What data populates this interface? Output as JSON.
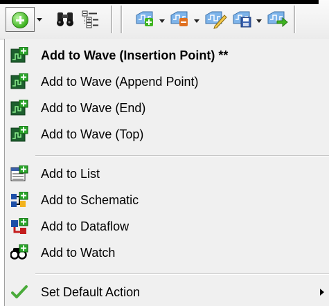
{
  "toolbar": {
    "icons": [
      "add-icon",
      "chevron-down-icon",
      "find-icon",
      "tree-icon",
      "wave-add-icon",
      "wave-remove-icon",
      "wave-edit-icon",
      "wave-save-icon",
      "wave-export-icon"
    ]
  },
  "menu": {
    "items": [
      {
        "label": "Add to Wave (Insertion Point) **",
        "icon": "wave-insert-icon",
        "bold": true
      },
      {
        "label": "Add to Wave (Append Point)",
        "icon": "wave-append-icon"
      },
      {
        "label": "Add to Wave (End)",
        "icon": "wave-end-icon"
      },
      {
        "label": "Add to Wave (Top)",
        "icon": "wave-top-icon"
      },
      {
        "label": "Add to List",
        "icon": "list-add-icon"
      },
      {
        "label": "Add to Schematic",
        "icon": "schematic-add-icon"
      },
      {
        "label": "Add to Dataflow",
        "icon": "dataflow-add-icon"
      },
      {
        "label": "Add to Watch",
        "icon": "watch-add-icon"
      },
      {
        "label": "Set Default Action",
        "icon": "checkmark-icon",
        "submenu": true
      }
    ]
  },
  "colors": {
    "menu_bg": "#f0f0f0",
    "accent_green": "#3fb421",
    "wave_blue": "#4a8fd8"
  }
}
